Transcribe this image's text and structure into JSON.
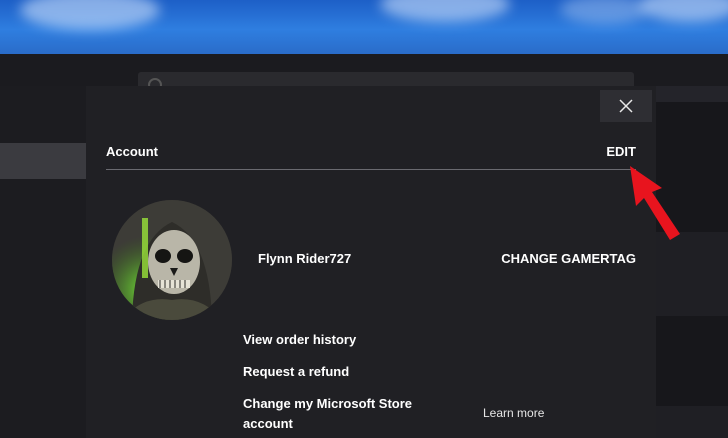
{
  "dialog": {
    "section_title": "Account",
    "edit_label": "EDIT",
    "gamertag": "Flynn Rider727",
    "change_gamertag_label": "CHANGE GAMERTAG",
    "links": {
      "order_history": "View order history",
      "refund": "Request a refund",
      "store_account_line1": "Change my Microsoft Store",
      "store_account_line2": "account"
    },
    "learn_more": "Learn more"
  },
  "icons": {
    "close": "close-icon",
    "search": "search-icon",
    "annotation": "red-arrow-icon"
  },
  "colors": {
    "dialog_bg": "#202024",
    "accent_arrow": "#e8141e",
    "text": "#ffffff"
  }
}
